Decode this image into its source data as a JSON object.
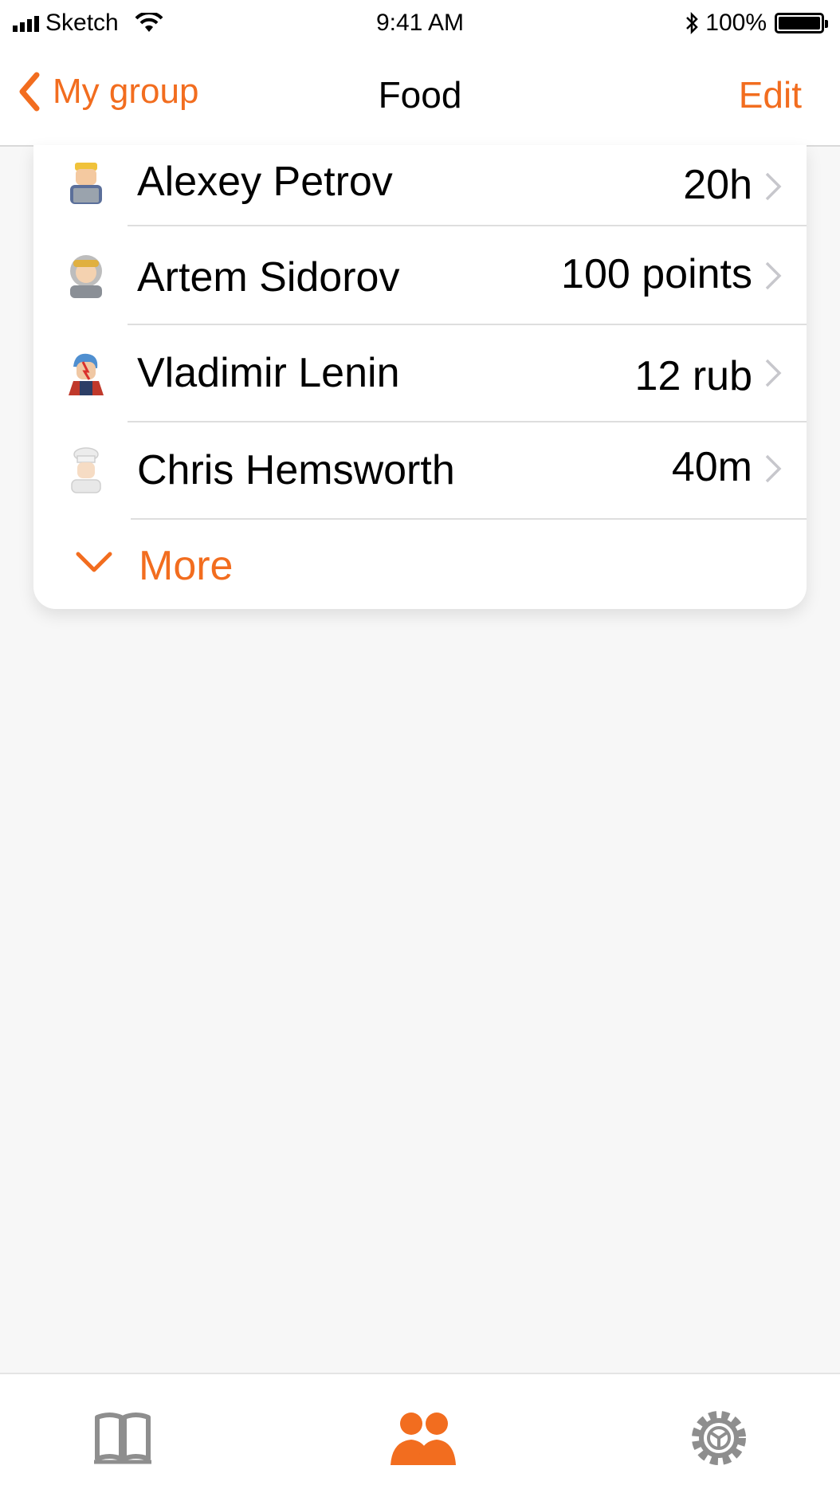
{
  "status_bar": {
    "carrier": "Sketch",
    "time": "9:41 AM",
    "battery": "100%"
  },
  "nav": {
    "back_label": "My group",
    "title": "Food",
    "edit_label": "Edit"
  },
  "members": [
    {
      "name": "Alexey Petrov",
      "value": "20h",
      "avatar": "technologist-avatar-icon"
    },
    {
      "name": "Artem Sidorov",
      "value": "100 points",
      "avatar": "astronaut-avatar-icon"
    },
    {
      "name": "Vladimir Lenin",
      "value": "12 rub",
      "avatar": "singer-avatar-icon"
    },
    {
      "name": "Chris Hemsworth",
      "value": "40m",
      "avatar": "cook-avatar-icon"
    }
  ],
  "more_label": "More",
  "tabs": [
    {
      "icon": "book-icon",
      "active": false
    },
    {
      "icon": "group-icon",
      "active": true
    },
    {
      "icon": "settings-gear-icon",
      "active": false
    }
  ],
  "colors": {
    "accent": "#f26d1f",
    "inactive": "#8e8e8e"
  }
}
